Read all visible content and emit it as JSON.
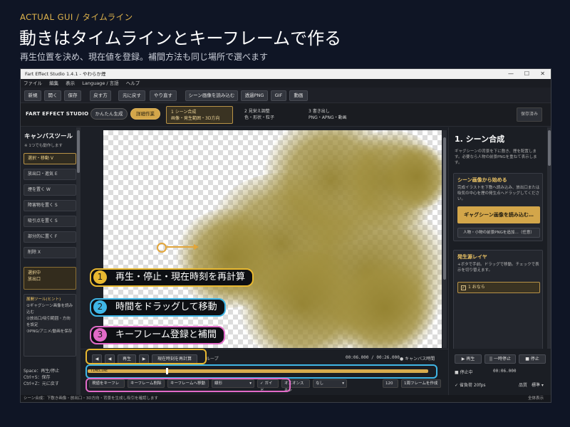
{
  "header": {
    "tag": "ACTUAL GUI / タイムライン",
    "title": "動きはタイムラインとキーフレームで作る",
    "subtitle": "再生位置を決め、現在値を登録。補間方法も同じ場所で選べます"
  },
  "window": {
    "title": "Fart Effect Studio 1.4.1 - やわらか煙",
    "menu": [
      "ファイル",
      "編集",
      "表示",
      "Language / 言語",
      "ヘルプ"
    ],
    "toolbar": [
      "新規",
      "開く",
      "保存",
      "戻す方",
      "元に戻す",
      "やり直す",
      "シーン画像を読み込む",
      "透過PNG",
      "GIF",
      "動画"
    ]
  },
  "steps": {
    "brand": "FART EFFECT STUDIO",
    "mode_simple": "かんたん生成",
    "mode_detail": "詳細作業",
    "step1_title": "1 シーン合成",
    "step1_sub": "画像・発生範囲・3D方向",
    "step2_title": "2 見栄え調整",
    "step2_sub": "色・形状・粒子",
    "step3_title": "3 書き出し",
    "step3_sub": "PNG・APNG・動画",
    "save_state": "保存済み"
  },
  "left_panel": {
    "title": "キャンバスツール",
    "subtitle": "※ 1つでも動作します",
    "tools": [
      "選択・移動 V",
      "放出口・進気 E",
      "煙を置く W",
      "障害物を置く S",
      "吸引点を置く S",
      "部分的に置く F",
      "削除 X"
    ],
    "selected_label": "選択中",
    "selected_value": "放出口",
    "hint_title": "展開ツール(ヒント)",
    "hints": [
      "①ギャグシーン画像を読み込む",
      "②放出口/吸引範囲・方向を設定",
      "③PNG/アニメ/動画を保存"
    ],
    "keys": [
      "Space：再生/停止",
      "Ctrl+S：保存",
      "Ctrl+Z：元に戻す"
    ]
  },
  "right_panel": {
    "title": "1. シーン合成",
    "desc": "ギャグシーンの背景を下に敷き、煙を配置します。必要なら人物の前景PNGを重ねて表示します。",
    "scene_box_title": "シーン画像から始める",
    "scene_box_text": "完成イラストを下敷へ読み込み、放出口または吸気の中心を煙の発生点へドラッグしてください。",
    "load_button": "ギャグシーン画像を読み込む…",
    "overlay_button": "人物・小物の前景PNGを追加…（任意）",
    "layer_title": "発生源レイヤ",
    "layer_text": "+ボタで手前。ドラッグで移動。チェックで表示を切り替えます。",
    "layer_item": "1 おなら"
  },
  "callouts": [
    {
      "num": "1",
      "text": "再生・停止・現在時刻を再計算"
    },
    {
      "num": "2",
      "text": "時間をドラッグして移動"
    },
    {
      "num": "3",
      "text": "キーフレーム登録と補間"
    }
  ],
  "timeline": {
    "prev_key": "◀",
    "prev": "◀",
    "play": "再生",
    "next": "▶",
    "recalc": "現在時刻を再計算",
    "loop": "ループ",
    "time_display": "00:06.000 / 00:26.000",
    "canvas_check": "キャンバス時間",
    "track_label": "TIMELINE",
    "progress": 0.23,
    "key_register": "現値をキーフレ",
    "key_delete": "キーフレーム削除",
    "key_move": "キーフレームへ移動",
    "interp": "線形",
    "guide": "ガイド",
    "onion": "オニオンスキン",
    "onion_val": "なし",
    "count": "120",
    "loop_btn": "1周フレームを作成"
  },
  "right_bottom": {
    "play": "▶ 再生",
    "pause": "|| 一時停止",
    "stop": "■ 停止",
    "status_label": "停止中",
    "status_time": "00:06.000",
    "fps_label": "省負荷 20fps",
    "quality_label": "品質",
    "quality_val": "標準"
  },
  "statusbar": {
    "left": "シーン合成：下敷き画像・放出口・3D方向・背景を生成し吸引を確認します",
    "right": "全体表示"
  },
  "colors": {
    "accent": "#d3a64a",
    "callout1": "#e8b830",
    "callout2": "#3fb6e6",
    "callout3": "#e26ac8"
  }
}
